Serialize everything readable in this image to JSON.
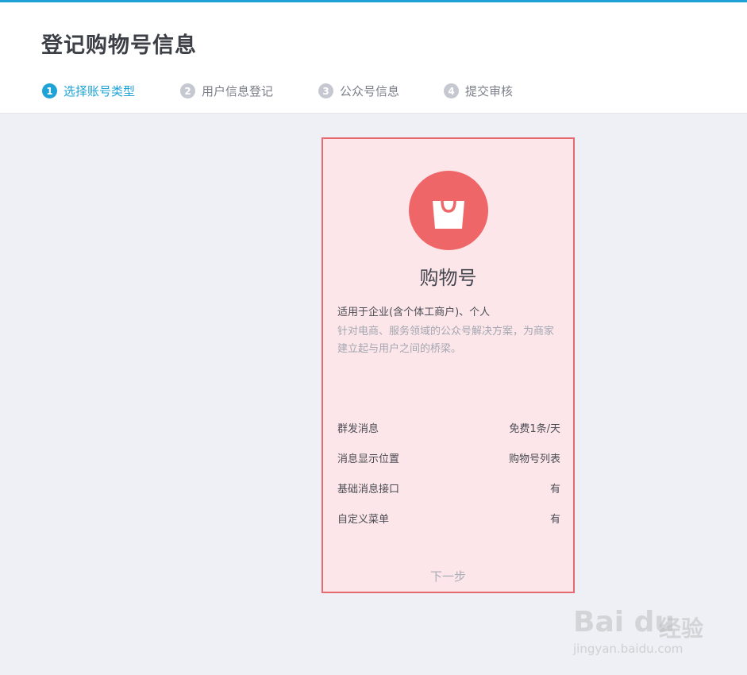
{
  "page": {
    "title": "登记购物号信息"
  },
  "steps": [
    {
      "num": "1",
      "label": "选择账号类型",
      "active": true
    },
    {
      "num": "2",
      "label": "用户信息登记",
      "active": false
    },
    {
      "num": "3",
      "label": "公众号信息",
      "active": false
    },
    {
      "num": "4",
      "label": "提交审核",
      "active": false
    }
  ],
  "card": {
    "icon": "shopping-bag-icon",
    "title": "购物号",
    "suitable": "适用于企业(含个体工商户)、个人",
    "description": "针对电商、服务领域的公众号解决方案，为商家建立起与用户之间的桥梁。",
    "features": [
      {
        "name": "群发消息",
        "value": "免费1条/天"
      },
      {
        "name": "消息显示位置",
        "value": "购物号列表"
      },
      {
        "name": "基础消息接口",
        "value": "有"
      },
      {
        "name": "自定义菜单",
        "value": "有"
      }
    ],
    "next_label": "下一步"
  },
  "colors": {
    "accent": "#1fa3d6",
    "card_border": "#e5696e",
    "card_bg": "#fde6e9",
    "icon_bg": "#ef6668"
  },
  "watermark": {
    "brand_en": "Bai du",
    "brand_cn": "经验",
    "url": "jingyan.baidu.com"
  }
}
